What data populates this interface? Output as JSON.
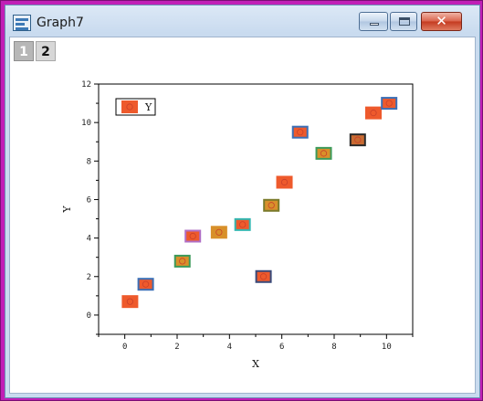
{
  "window": {
    "title": "Graph7",
    "buttons": {
      "close_glyph": "✕"
    }
  },
  "layers": [
    "1",
    "2"
  ],
  "colors": {
    "frame": "#c11fb6",
    "marker_fill_default": "#ee5a2c"
  },
  "chart_data": {
    "type": "scatter",
    "xlabel": "X",
    "ylabel": "Y",
    "xlim": [
      -1,
      11
    ],
    "ylim": [
      -1,
      12
    ],
    "xticks": [
      0,
      2,
      4,
      6,
      8,
      10
    ],
    "yticks": [
      0,
      2,
      4,
      6,
      8,
      10,
      12
    ],
    "grid": false,
    "legend": {
      "position": "top-left",
      "entries": [
        {
          "label": "Y"
        }
      ]
    },
    "series": [
      {
        "name": "Y",
        "points": [
          {
            "x": 0.2,
            "y": 0.7,
            "fill": "#ee5a2c",
            "edge": "#ee5a2c"
          },
          {
            "x": 0.8,
            "y": 1.6,
            "fill": "#ee5a2c",
            "edge": "#3b6fb6"
          },
          {
            "x": 2.2,
            "y": 2.8,
            "fill": "#d8902a",
            "edge": "#3c9a5a"
          },
          {
            "x": 2.6,
            "y": 4.1,
            "fill": "#ee5a2c",
            "edge": "#b06fc6"
          },
          {
            "x": 3.6,
            "y": 4.3,
            "fill": "#d8902a",
            "edge": "#d8902a"
          },
          {
            "x": 4.5,
            "y": 4.7,
            "fill": "#ee5a2c",
            "edge": "#33b6b0"
          },
          {
            "x": 5.3,
            "y": 2.0,
            "fill": "#ee5a2c",
            "edge": "#3a4a7a"
          },
          {
            "x": 5.6,
            "y": 5.7,
            "fill": "#d8902a",
            "edge": "#7a7a2a"
          },
          {
            "x": 6.1,
            "y": 6.9,
            "fill": "#ee5a2c",
            "edge": "#ee5a2c"
          },
          {
            "x": 6.7,
            "y": 9.5,
            "fill": "#ee5a2c",
            "edge": "#3b6fb6"
          },
          {
            "x": 7.6,
            "y": 8.4,
            "fill": "#d8902a",
            "edge": "#3c9a5a"
          },
          {
            "x": 8.9,
            "y": 9.1,
            "fill": "#c86b32",
            "edge": "#2a2a2a"
          },
          {
            "x": 9.5,
            "y": 10.5,
            "fill": "#ee5a2c",
            "edge": "#ee5a2c"
          },
          {
            "x": 10.1,
            "y": 11.0,
            "fill": "#ee5a2c",
            "edge": "#3b6fb6"
          }
        ]
      }
    ]
  }
}
